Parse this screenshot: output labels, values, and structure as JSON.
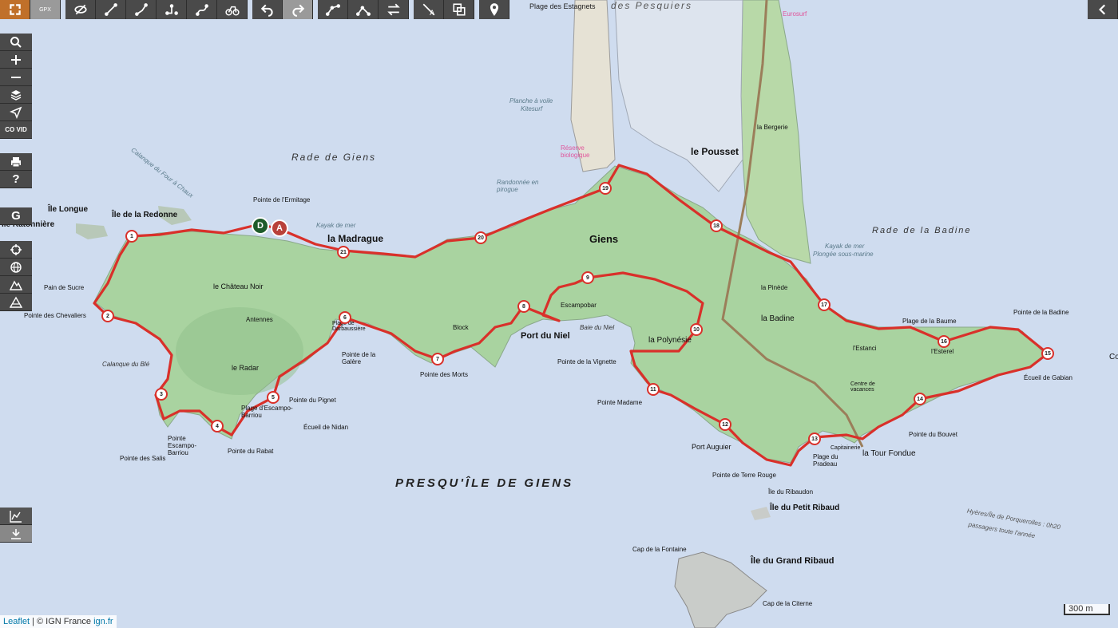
{
  "toolbar": {
    "buttons": [
      {
        "name": "fullscreen-button",
        "icon": "expand-icon"
      },
      {
        "name": "gpx-button",
        "icon": "gpx-icon",
        "label": "GPX"
      },
      {
        "name": "hide-track-button",
        "icon": "eye-slash-icon"
      },
      {
        "name": "draw-line-button",
        "icon": "line-icon"
      },
      {
        "name": "draw-route-button",
        "icon": "route-icon"
      },
      {
        "name": "draw-path-button",
        "icon": "path-icon"
      },
      {
        "name": "draw-curve-button",
        "icon": "curve-icon"
      },
      {
        "name": "bike-route-button",
        "icon": "bike-icon"
      },
      {
        "name": "undo-button",
        "icon": "undo-icon"
      },
      {
        "name": "redo-button",
        "icon": "redo-icon"
      },
      {
        "name": "merge-button",
        "icon": "merge-icon"
      },
      {
        "name": "split-button",
        "icon": "split-icon"
      },
      {
        "name": "reverse-button",
        "icon": "swap-icon"
      },
      {
        "name": "clear-waypoints-button",
        "icon": "waypoint-clear-icon"
      },
      {
        "name": "copy-button",
        "icon": "copy-icon"
      },
      {
        "name": "marker-button",
        "icon": "map-pin-icon"
      }
    ],
    "menu_icon": "menu-icon"
  },
  "sidebar": {
    "covid_label": "CO VID",
    "help_label": "?",
    "g_label": "G"
  },
  "attribution": {
    "leaflet": "Leaflet",
    "ign": "© IGN France",
    "ignfr": "ign.fr"
  },
  "scale_label": "300 m",
  "map_labels": {
    "presquile": "PRESQU'ÎLE  DE  GIENS",
    "rade_giens": "Rade  de  Giens",
    "rade_badine": "Rade   de   la   Badine",
    "des_pesquiers": "des Pesquiers",
    "plage_estagnets": "Plage des Estagnets",
    "giens": "Giens",
    "madrague": "la Madrague",
    "le_pousset": "le Pousset",
    "port_niel": "Port du Niel",
    "ile_longue": "Île Longue",
    "ile_redonne": "Île de la Redonne",
    "ile_grand_ribaud": "Île du Grand Ribaud",
    "ile_petit_ribaud": "Île du Petit Ribaud",
    "ile_ribaudon": "Île du Ribaudon",
    "la_tour_fondue": "la Tour Fondue",
    "la_badine": "la Badine",
    "la_polynesie": "la Polynésie",
    "le_radar": "le Radar",
    "chateau_noir": "le Château Noir",
    "antennes": "Antennes",
    "pointe_ermitage": "Pointe de l'Ermitage",
    "pointe_sucre": "Pain de Sucre",
    "pointe_chevaliers": "Pointe des Chevaliers",
    "calanque_ble": "Calanque du Blé",
    "pointe_salis": "Pointe des Salis",
    "pointe_escampo": "Pointe Escampo-Barriou",
    "pointe_rabat": "Pointe du Rabat",
    "plage_escampo": "Plage d'Escampo-Barriou",
    "ecueil_nidan": "Écueil de Nidan",
    "pointe_pignet": "Pointe du Pignet",
    "pointe_galere": "Pointe de la Galère",
    "pointe_morts": "Pointe des Morts",
    "pointe_vignette": "Pointe de la Vignette",
    "pointe_madame": "Pointe Madame",
    "port_auguier": "Port Auguier",
    "pointe_terre_rouge": "Pointe de Terre Rouge",
    "plage_pradeau": "Plage du Pradeau",
    "pointe_bouvet": "Pointe du Bouvet",
    "ecueil_gabian": "Écueil de Gabian",
    "pointe_badine": "Pointe de la Badine",
    "plage_baume": "Plage de la Baume",
    "cap_fontaine": "Cap de la Fontaine",
    "cap_citerne": "Cap de la Citerne",
    "ferry": "Hyères/Île de Porquerolles : 0h20",
    "ferry2": "passagers toute l'année",
    "planche": "Planche à voile",
    "kitesurf": "Kitesurf",
    "reserve": "Réserve biologique",
    "randonnee": "Randonnée en pirogue",
    "kayak1": "Kayak de mer",
    "kayak2": "Kayak de mer",
    "plongee": "Plongée sous-marine",
    "calanque_four": "Calanque du Four à Chaux",
    "escampobar": "Escampobar",
    "baie_niel": "Baie du Niel",
    "estanci": "l'Estanci",
    "esterel": "l'Esterel",
    "pinede": "la Pinède",
    "bergerie": "la Bergerie",
    "capitainerie": "Capitainerie",
    "centre_vacances": "Centre de vacances",
    "block": "Block",
    "darbaussiere": "Plage de Darbaussière",
    "eurosurf": "Eurosurf",
    "ile_ratonniere": "Île Ratonnière",
    "polynesie_label": "la Polynésie",
    "cap_co": "Co"
  },
  "waypoints": [
    "1",
    "2",
    "3",
    "4",
    "5",
    "6",
    "7",
    "8",
    "9",
    "10",
    "11",
    "12",
    "13",
    "14",
    "15",
    "16",
    "17",
    "18",
    "19",
    "20",
    "21"
  ],
  "markers": {
    "depart": "D",
    "arrivee": "A"
  },
  "colors": {
    "sea": "#cfdcef",
    "land": "#a8d5a2",
    "track": "#d9302a",
    "wp_border": "#d9302a",
    "depart": "#1e5b2a",
    "arrivee": "#b9413a"
  }
}
